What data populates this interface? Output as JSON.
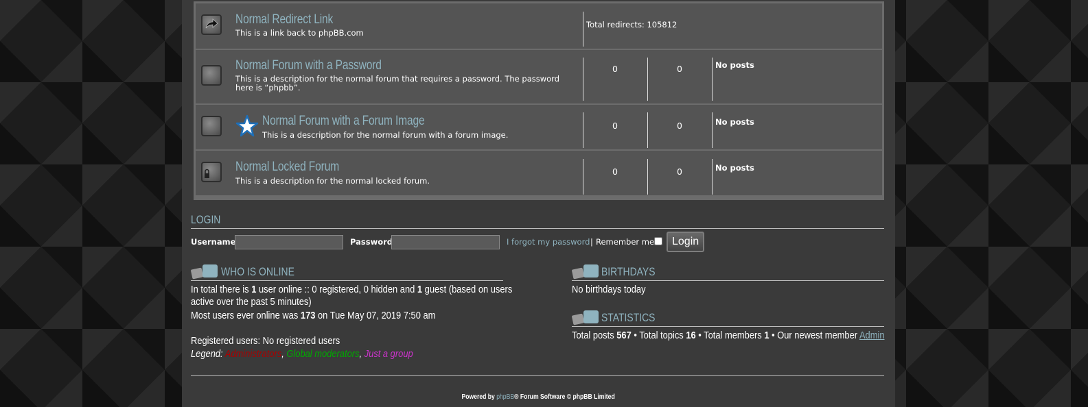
{
  "forums": [
    {
      "title": "Normal Redirect Link",
      "desc": "This is a link back to phpBB.com",
      "type": "redirect",
      "redirects_text": "Total redirects: 105812",
      "icon": "redirect-arrow-icon"
    },
    {
      "title": "Normal Forum with a Password",
      "desc": "This is a description for the normal forum that requires a password. The password here is “phpbb”.",
      "topics": "0",
      "posts": "0",
      "last_post": "No posts",
      "icon": "forum-read-icon"
    },
    {
      "title": "Normal Forum with a Forum Image",
      "desc": "This is a description for the normal forum with a forum image.",
      "topics": "0",
      "posts": "0",
      "last_post": "No posts",
      "icon": "forum-read-icon",
      "image": "star-icon"
    },
    {
      "title": "Normal Locked Forum",
      "desc": "This is a description for the normal locked forum.",
      "topics": "0",
      "posts": "0",
      "last_post": "No posts",
      "icon": "forum-locked-icon"
    }
  ],
  "login": {
    "heading": "LOGIN",
    "username_label": "Username:",
    "username_value": "",
    "password_label": "Password:",
    "password_value": "",
    "forgot_link": "I forgot my password",
    "separator": "|",
    "remember_label": "Remember me",
    "button": "Login"
  },
  "who_is_online": {
    "heading": "WHO IS ONLINE",
    "line1_pre": "In total there is ",
    "line1_count": "1",
    "line1_mid": " user online :: 0 registered, 0 hidden and ",
    "line1_guests": "1",
    "line1_post": " guest (based on users",
    "line2": "active over the past 5 minutes)",
    "record_pre": "Most users ever online was ",
    "record_count": "173",
    "record_post": " on Tue May 07, 2019 7:50 am",
    "registered": "Registered users: No registered users",
    "legend_label": "Legend:",
    "legend_admin": "Administrators",
    "legend_mods": "Global moderators",
    "legend_group": "Just a group",
    "legend_sep": ", "
  },
  "birthdays": {
    "heading": "BIRTHDAYS",
    "text": "No birthdays today"
  },
  "statistics": {
    "heading": "STATISTICS",
    "posts_pre": "Total posts ",
    "posts": "567",
    "topics_pre": " • Total topics ",
    "topics": "16",
    "members_pre": " • Total members ",
    "members": "1",
    "newest_pre": " • Our newest member ",
    "newest": "Admin"
  },
  "footer": {
    "pre": "Powered by ",
    "link": "phpBB",
    "post": "® Forum Software © phpBB Limited"
  },
  "colors": {
    "link": "#8fb3bf",
    "admin": "#aa0000",
    "mods": "#00aa00",
    "group": "#cc33cc"
  }
}
